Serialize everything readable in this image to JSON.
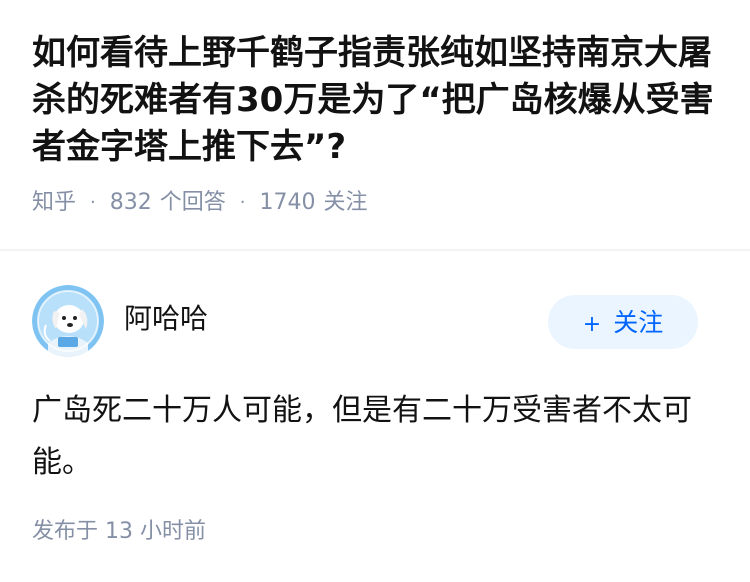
{
  "question": {
    "title": "如何看待上野千鹤子指责张纯如坚持南京大屠杀的死难者有30万是为了“把广岛核爆从受害者金字塔上推下去”?",
    "source": "知乎",
    "answers_count": "832",
    "answers_label": "个回答",
    "followers_count": "1740",
    "followers_label": "关注"
  },
  "answer": {
    "author": {
      "name": "阿哈哈",
      "avatar_icon": "cartoon-dog-astronaut-avatar"
    },
    "follow_button": {
      "plus": "+",
      "label": "关注"
    },
    "content": "广岛死二十万人可能，但是有二十万受害者不太可能。",
    "published": "发布于 13 小时前"
  },
  "colors": {
    "title": "#121212",
    "meta": "#8590a6",
    "accent": "#0066ff",
    "follow_bg": "#ebf5ff",
    "avatar_bg": "#7ec3f2"
  }
}
